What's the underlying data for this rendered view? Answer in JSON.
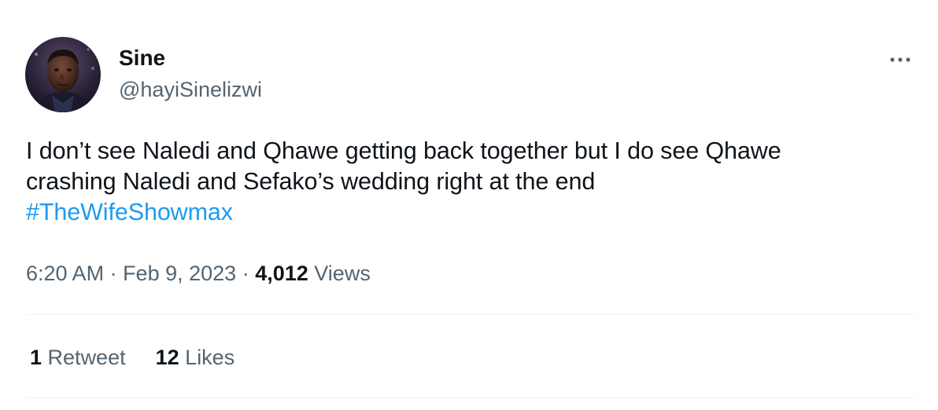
{
  "author": {
    "display_name": "Sine",
    "handle": "@hayiSinelizwi"
  },
  "icons": {
    "avatar": "profile-photo",
    "more": "more-horizontal-icon"
  },
  "tweet": {
    "line1": "I don’t see Naledi and Qhawe getting back together but I do see Qhawe",
    "line2": "crashing Naledi and Sefako’s wedding right at the end",
    "hashtag": "#TheWifeShowmax"
  },
  "meta": {
    "time": "6:20 AM",
    "separator1": " · ",
    "date": "Feb 9, 2023",
    "separator2": " · ",
    "views_count": "4,012",
    "views_label": "Views"
  },
  "stats": {
    "retweets_count": "1",
    "retweets_label": "Retweet",
    "likes_count": "12",
    "likes_label": "Likes"
  },
  "colors": {
    "text_primary": "#0f1419",
    "text_secondary": "#536471",
    "link": "#1d9bf0",
    "divider": "#eff3f4",
    "background": "#ffffff"
  }
}
